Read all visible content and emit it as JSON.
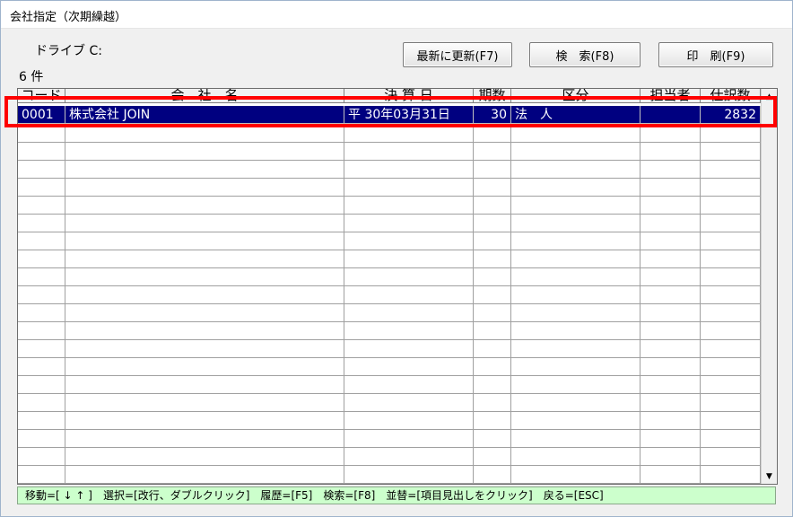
{
  "window": {
    "title": "会社指定（次期繰越）"
  },
  "info": {
    "drive": "ドライブ C:",
    "count": "6 件"
  },
  "toolbar": {
    "refresh_label": "最新に更新(F7)",
    "search_label": "検　索(F8)",
    "print_label": "印　刷(F9)"
  },
  "table": {
    "headers": [
      "コード",
      "会　社　名",
      "決 算 日",
      "期数",
      "区分",
      "担当者",
      "仕訳数"
    ],
    "rows": [
      {
        "code": "0001",
        "company": "株式会社  JOIN",
        "closing": "平 30年03月31日",
        "period": "30",
        "category": "法　人",
        "staff": "",
        "entries": "2832"
      }
    ]
  },
  "statusbar": {
    "text": "移動=[ ↓ ↑ ]　選択=[改行、ダブルクリック]　履歴=[F5]　検索=[F8]　並替=[項目見出しをクリック]　戻る=[ESC]"
  },
  "colors": {
    "selection": "#000080",
    "highlight": "#ff0000",
    "status_bg": "#ccffcc"
  }
}
